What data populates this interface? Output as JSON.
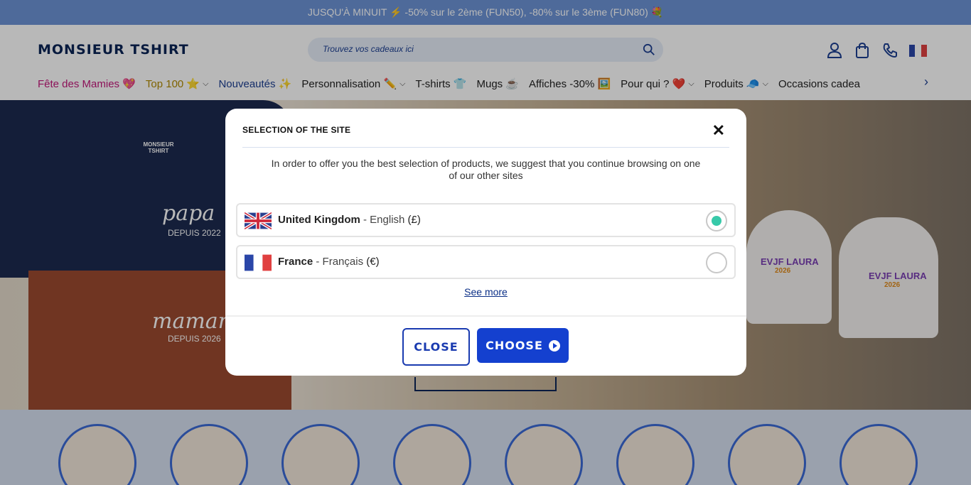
{
  "banner": {
    "text": "JUSQU'À MINUIT ⚡ -50% sur le 2ème (FUN50), -80% sur le 3ème (FUN80) 💐"
  },
  "header": {
    "logo": "MONSIEUR TSHIRT",
    "search_placeholder": "Trouvez vos cadeaux ici",
    "icons": [
      "user-icon",
      "bag-icon",
      "phone-icon",
      "flag-fr-icon"
    ]
  },
  "nav": [
    {
      "label": "Fête des Mamies 💖",
      "color": "#c2187a",
      "dropdown": false
    },
    {
      "label": "Top 100 ⭐",
      "color": "#b08a00",
      "dropdown": true
    },
    {
      "label": "Nouveautés ✨",
      "color": "#1c3f92",
      "dropdown": false
    },
    {
      "label": "Personnalisation ✏️",
      "color": "#222222",
      "dropdown": true
    },
    {
      "label": "T-shirts 👕",
      "color": "#222222",
      "dropdown": false
    },
    {
      "label": "Mugs ☕",
      "color": "#222222",
      "dropdown": false
    },
    {
      "label": "Affiches -30% 🖼️",
      "color": "#222222",
      "dropdown": false
    },
    {
      "label": "Pour qui ? ❤️",
      "color": "#222222",
      "dropdown": true
    },
    {
      "label": "Produits 🧢",
      "color": "#222222",
      "dropdown": true
    },
    {
      "label": "Occasions cadea",
      "color": "#222222",
      "dropdown": false
    }
  ],
  "hero": {
    "shirt_top_text": "papa",
    "shirt_top_sub": "DEPUIS 2022",
    "shirt_bottom_text": "mamar",
    "shirt_bottom_sub": "DEPUIS 2026",
    "shirt_brand": "MONSIEUR TSHIRT",
    "tee_text_1": "EVJF LAURA",
    "tee_year_1": "2026",
    "tee_text_2": "EVJF LAURA",
    "tee_year_2": "2026"
  },
  "modal": {
    "title": "SELECTION OF THE SITE",
    "description": "In order to offer you the best selection of products, we suggest that you continue browsing on one of our other sites",
    "options": [
      {
        "country": "United Kingdom",
        "sep": " - ",
        "language": "English",
        "currency": "(£)",
        "selected": true
      },
      {
        "country": "France",
        "sep": " - ",
        "language": "Français",
        "currency": "(€)",
        "selected": false
      }
    ],
    "see_more": "See more",
    "close_label": "CLOSE",
    "choose_label": "CHOOSE"
  },
  "colors": {
    "primary": "#1440cf",
    "banner": "#6c93d6",
    "radio_selected": "#37c9a9"
  }
}
